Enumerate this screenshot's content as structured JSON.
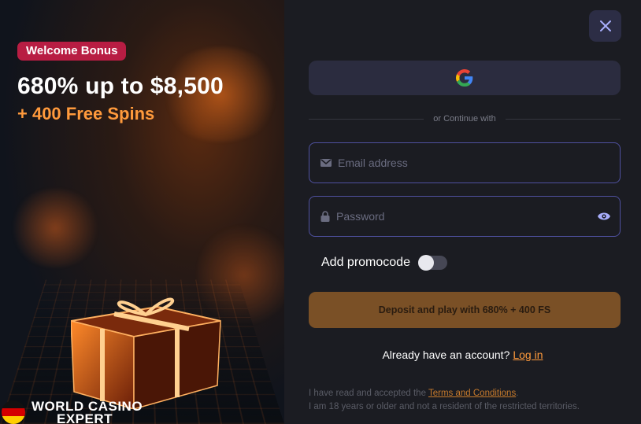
{
  "promo": {
    "badge": "Welcome Bonus",
    "headline": "680% up to $8,500",
    "subline": "+ 400 Free Spins",
    "brand_line1": "WORLD CASINO",
    "brand_line2": "EXPERT"
  },
  "form": {
    "close_icon": "close-icon",
    "google_icon": "google-icon",
    "divider_text": "or Continue with",
    "email": {
      "placeholder": "Email address",
      "value": ""
    },
    "password": {
      "placeholder": "Password",
      "value": ""
    },
    "promocode_label": "Add promocode",
    "promocode_enabled": false,
    "cta_label": "Deposit and play with 680% + 400 FS",
    "already_text": "Already have an account?",
    "login_link": "Log in",
    "terms_prefix": "I have read and accepted the",
    "terms_link": "Terms and Conditions",
    "terms_suffix": ".",
    "terms_line2": "I am 18 years or older and not a resident of the restricted territories."
  },
  "colors": {
    "badge_bg": "#b81d43",
    "accent_orange": "#ff9a3c",
    "panel_bg": "#1b1c22",
    "field_border": "#4f51a0",
    "cta_bg": "#7a5026"
  }
}
